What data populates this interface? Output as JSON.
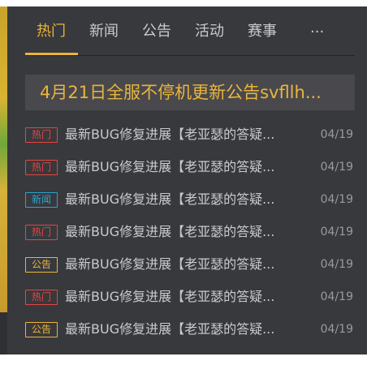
{
  "tabs": [
    {
      "label": "热门",
      "active": true
    },
    {
      "label": "新闻",
      "active": false
    },
    {
      "label": "公告",
      "active": false
    },
    {
      "label": "活动",
      "active": false
    },
    {
      "label": "赛事",
      "active": false
    },
    {
      "label": "...",
      "active": false
    }
  ],
  "banner": {
    "text": "4月21日全服不停机更新公告svfllh..."
  },
  "colors": {
    "accent": "#eab53a",
    "hot": "#e5453f",
    "news": "#2ba4cf",
    "panel": "#38393d"
  },
  "news_list": [
    {
      "tag": "热门",
      "tag_type": "hot",
      "title": "最新BUG修复进展【老亚瑟的答疑...",
      "date": "04/19"
    },
    {
      "tag": "热门",
      "tag_type": "hot",
      "title": "最新BUG修复进展【老亚瑟的答疑...",
      "date": "04/19"
    },
    {
      "tag": "新闻",
      "tag_type": "news",
      "title": "最新BUG修复进展【老亚瑟的答疑...",
      "date": "04/19"
    },
    {
      "tag": "热门",
      "tag_type": "hot",
      "title": "最新BUG修复进展【老亚瑟的答疑...",
      "date": "04/19"
    },
    {
      "tag": "公告",
      "tag_type": "notice",
      "title": "最新BUG修复进展【老亚瑟的答疑...",
      "date": "04/19"
    },
    {
      "tag": "热门",
      "tag_type": "hot",
      "title": "最新BUG修复进展【老亚瑟的答疑...",
      "date": "04/19"
    },
    {
      "tag": "公告",
      "tag_type": "notice",
      "title": "最新BUG修复进展【老亚瑟的答疑...",
      "date": "04/19"
    }
  ]
}
